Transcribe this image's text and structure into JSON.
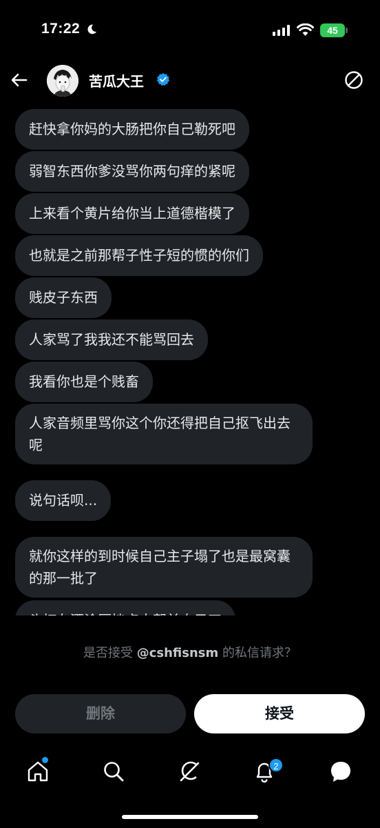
{
  "status_bar": {
    "time": "17:22",
    "battery": "45"
  },
  "header": {
    "name": "苦瓜大王"
  },
  "messages": [
    "赶快拿你妈的大肠把你自己勒死吧",
    "弱智东西你爹没骂你两句痒的紧呢",
    "上来看个黄片给你当上道德楷模了",
    "也就是之前那帮子性子短的惯的你们",
    "贱皮子东西",
    "人家骂了我我还不能骂回去",
    "我看你也是个贱畜",
    "人家音频里骂你这个你还得把自己抠飞出去呢",
    "说句话呗...",
    "就你这样的到时候自己主子塌了也是最窝囊的那一批了",
    "头打在酒涂厨挫点十帮兼自己四"
  ],
  "request": {
    "prefix": "是否接受 ",
    "handle": "@cshfisnsm",
    "suffix": " 的私信请求？"
  },
  "actions": {
    "delete_label": "删除",
    "accept_label": "接受"
  },
  "tabbar": {
    "items": [
      "home-icon",
      "search-icon",
      "grok-icon",
      "notifications-icon",
      "messages-icon"
    ],
    "notifications_count": "2"
  },
  "colors": {
    "accent": "#1d9bf0",
    "bubble": "#202327",
    "battery": "#34c759"
  }
}
